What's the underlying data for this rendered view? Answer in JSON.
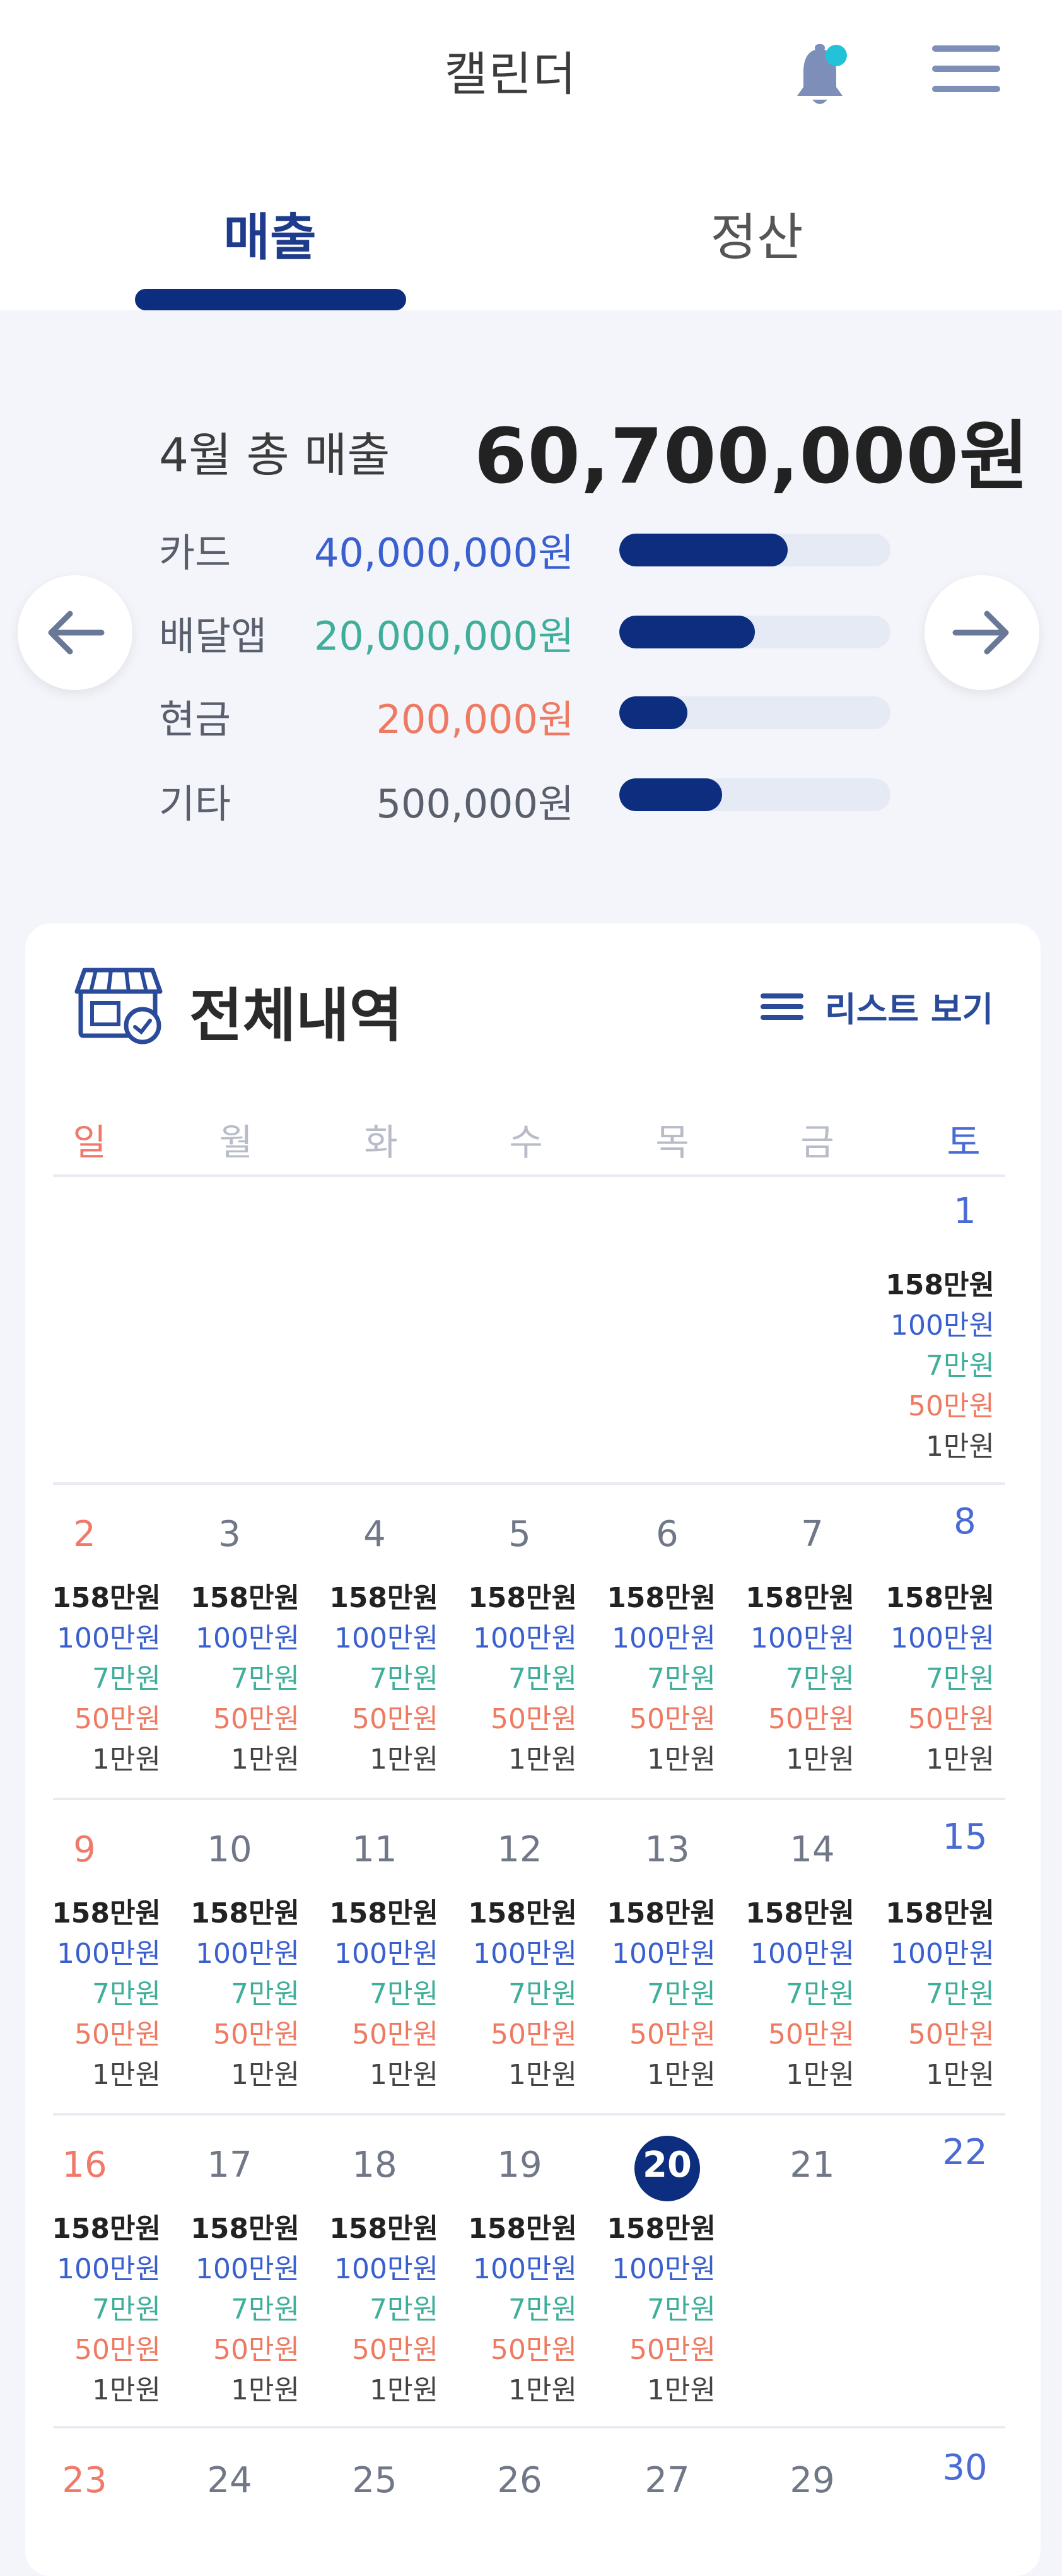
{
  "header": {
    "title": "캘린더",
    "tabs": [
      {
        "label": "매출",
        "active": true
      },
      {
        "label": "정산",
        "active": false
      }
    ]
  },
  "summary": {
    "label": "4월 총 매출",
    "total": "60,700,000원",
    "rows": [
      {
        "label": "카드",
        "value": "40,000,000원",
        "color": "#3a5fcf",
        "share": 0.62
      },
      {
        "label": "배달앱",
        "value": "20,000,000원",
        "color": "#3fae9a",
        "share": 0.5
      },
      {
        "label": "현금",
        "value": "200,000원",
        "color": "#ef7a62",
        "share": 0.25
      },
      {
        "label": "기타",
        "value": "500,000원",
        "color": "#5a5f6e",
        "share": 0.38
      }
    ]
  },
  "history": {
    "title": "전체내역",
    "list_view": "리스트 보기"
  },
  "weekdays": [
    "일",
    "월",
    "화",
    "수",
    "목",
    "금",
    "토"
  ],
  "amounts": {
    "total": "158만원",
    "card": "100만원",
    "app": "7만원",
    "cash": "50만원",
    "etc": "1만원"
  },
  "calendar": {
    "today": "20",
    "weeks": [
      [
        "",
        "",
        "",
        "",
        "",
        "",
        "1"
      ],
      [
        "2",
        "3",
        "4",
        "5",
        "6",
        "7",
        "8"
      ],
      [
        "9",
        "10",
        "11",
        "12",
        "13",
        "14",
        "15"
      ],
      [
        "16",
        "17",
        "18",
        "19",
        "20",
        "21",
        "22"
      ],
      [
        "23",
        "24",
        "25",
        "26",
        "27",
        "29",
        "30"
      ]
    ],
    "has_sales": [
      [
        false,
        false,
        false,
        false,
        false,
        false,
        true
      ],
      [
        true,
        true,
        true,
        true,
        true,
        true,
        true
      ],
      [
        true,
        true,
        true,
        true,
        true,
        true,
        true
      ],
      [
        true,
        true,
        true,
        true,
        true,
        false,
        false
      ],
      [
        false,
        false,
        false,
        false,
        false,
        false,
        false
      ]
    ]
  },
  "colors": {
    "accent": "#0d2d7e",
    "card": "#3a5fcf",
    "app": "#3fae9a",
    "cash": "#ef7a62"
  }
}
